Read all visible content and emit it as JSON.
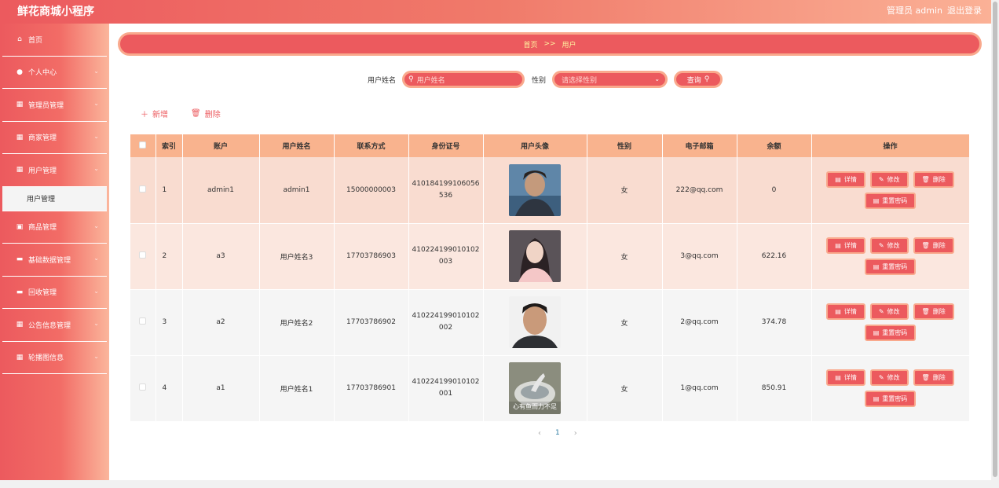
{
  "app": {
    "title": "鲜花商城小程序",
    "admin": "管理员 admin",
    "logout": "退出登录"
  },
  "sidebar": {
    "items": [
      {
        "label": "首页",
        "icon": "home-icon",
        "glyph": "⌂"
      },
      {
        "label": "个人中心",
        "icon": "user-icon",
        "glyph": "●"
      },
      {
        "label": "管理员管理",
        "icon": "grid-icon",
        "glyph": "▦"
      },
      {
        "label": "商家管理",
        "icon": "grid-icon",
        "glyph": "▦"
      },
      {
        "label": "用户管理",
        "icon": "grid-icon",
        "glyph": "▦"
      },
      {
        "label": "商品管理",
        "icon": "box-icon",
        "glyph": "▣"
      },
      {
        "label": "基础数据管理",
        "icon": "monitor-icon",
        "glyph": "▬"
      },
      {
        "label": "回收管理",
        "icon": "monitor-icon",
        "glyph": "▬"
      },
      {
        "label": "公告信息管理",
        "icon": "grid-icon",
        "glyph": "▦"
      },
      {
        "label": "轮播图信息",
        "icon": "grid-icon",
        "glyph": "▦"
      }
    ],
    "sub_item": "用户管理"
  },
  "breadcrumb": {
    "home": "首页",
    "sep": ">>",
    "current": "用户"
  },
  "search": {
    "name_label": "用户姓名",
    "name_placeholder": "用户姓名",
    "gender_label": "性别",
    "gender_placeholder": "请选择性别",
    "query_label": "查询"
  },
  "toolbar": {
    "add": "新增",
    "delete": "删除"
  },
  "table": {
    "headers": [
      "索引",
      "账户",
      "用户姓名",
      "联系方式",
      "身份证号",
      "用户头像",
      "性别",
      "电子邮箱",
      "余额",
      "操作"
    ],
    "rows": [
      {
        "index": "1",
        "account": "admin1",
        "name": "admin1",
        "phone": "15000000003",
        "id_card": "410184199106056536",
        "gender": "女",
        "email": "222@qq.com",
        "balance": "0",
        "avatar_caption": ""
      },
      {
        "index": "2",
        "account": "a3",
        "name": "用户姓名3",
        "phone": "17703786903",
        "id_card": "410224199010102003",
        "gender": "女",
        "email": "3@qq.com",
        "balance": "622.16",
        "avatar_caption": ""
      },
      {
        "index": "3",
        "account": "a2",
        "name": "用户姓名2",
        "phone": "17703786902",
        "id_card": "410224199010102002",
        "gender": "女",
        "email": "2@qq.com",
        "balance": "374.78",
        "avatar_caption": ""
      },
      {
        "index": "4",
        "account": "a1",
        "name": "用户姓名1",
        "phone": "17703786901",
        "id_card": "410224199010102001",
        "gender": "女",
        "email": "1@qq.com",
        "balance": "850.91",
        "avatar_caption": "心有鱼而力不足"
      }
    ],
    "ops": {
      "detail": "详情",
      "edit": "修改",
      "delete": "删除",
      "reset": "重置密码"
    }
  },
  "pagination": {
    "prev": "‹",
    "current": "1",
    "next": "›"
  },
  "colors": {
    "primary": "#ec5a5e",
    "border": "#f9a98d",
    "header": "#f9b38e",
    "breadcrumb_text": "#fff3a0"
  }
}
